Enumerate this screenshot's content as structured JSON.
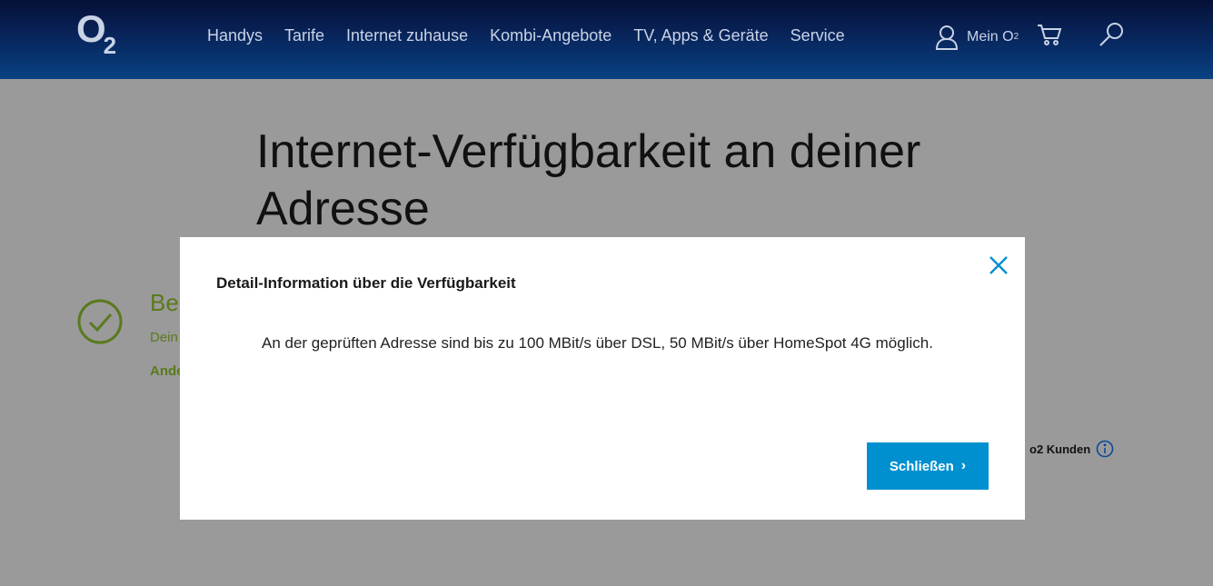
{
  "header": {
    "logo": "O",
    "logo_sub": "2",
    "nav": [
      "Handys",
      "Tarife",
      "Internet zuhause",
      "Kombi-Angebote",
      "TV, Apps & Geräte",
      "Service"
    ],
    "mein_label": "Mein O",
    "mein_sub": "2"
  },
  "page": {
    "title": "Internet-Verfügbarkeit an deiner Adresse",
    "heading_partial": "Bei",
    "sub_partial": "Dein",
    "link_partial": "Ande",
    "kunden_label": "o2 Kunden"
  },
  "modal": {
    "title": "Detail-Information über die Verfügbarkeit",
    "body": "An der geprüften Adresse sind bis zu 100 MBit/s über DSL, 50 MBit/s über HomeSpot 4G möglich.",
    "close_button_label": "Schließen"
  },
  "colors": {
    "accent": "#0090d0",
    "success": "#5a7a1e",
    "overlay": "#9a9a9a"
  }
}
